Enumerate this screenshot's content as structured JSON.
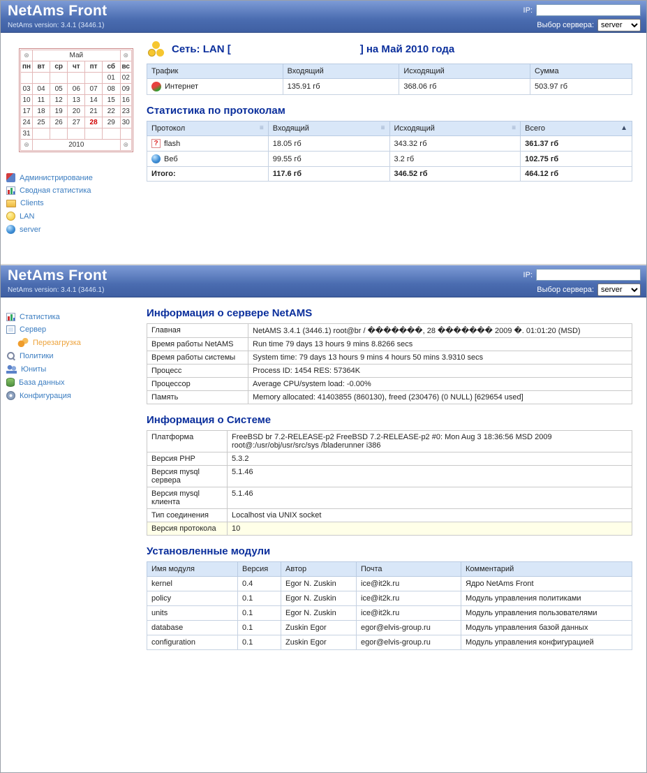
{
  "header": {
    "title": "NetAms Front",
    "version": "NetAms version: 3.4.1 (3446.1)",
    "ip_label": "IP:",
    "server_label": "Выбор сервера:",
    "server_option": "server"
  },
  "icons": {
    "sort": "≡",
    "sort_active": "▲",
    "nav": "⊛",
    "flash_glyph": "?"
  },
  "section1": {
    "calendar": {
      "month": "Май",
      "year": "2010",
      "dow": [
        "пн",
        "вт",
        "ср",
        "чт",
        "пт",
        "сб",
        "вс"
      ],
      "weeks": [
        [
          "",
          "",
          "",
          "",
          "",
          "01",
          "02"
        ],
        [
          "03",
          "04",
          "05",
          "06",
          "07",
          "08",
          "09"
        ],
        [
          "10",
          "11",
          "12",
          "13",
          "14",
          "15",
          "16"
        ],
        [
          "17",
          "18",
          "19",
          "20",
          "21",
          "22",
          "23"
        ],
        [
          "24",
          "25",
          "26",
          "27",
          "28",
          "29",
          "30"
        ],
        [
          "31",
          "",
          "",
          "",
          "",
          "",
          ""
        ]
      ],
      "selected_day": "28"
    },
    "menu": [
      "Администрирование",
      "Сводная статистика",
      "Clients",
      "LAN",
      "server"
    ],
    "net_title_prefix": "Сеть: LAN [",
    "net_title_suffix": "] на Май 2010 года",
    "traffic": {
      "headers": [
        "Трафик",
        "Входящий",
        "Исходящий",
        "Сумма"
      ],
      "row": [
        "Интернет",
        "135.91 гб",
        "368.06 гб",
        "503.97 гб"
      ]
    },
    "protocols": {
      "heading": "Статистика по протоколам",
      "headers": [
        "Протокол",
        "Входящий",
        "Исходящий",
        "Всего"
      ],
      "rows": [
        [
          "flash",
          "18.05 гб",
          "343.32 гб",
          "361.37 гб"
        ],
        [
          "Веб",
          "99.55 гб",
          "3.2 гб",
          "102.75 гб"
        ]
      ],
      "total": [
        "Итого:",
        "117.6 гб",
        "346.52 гб",
        "464.12 гб"
      ]
    }
  },
  "section2": {
    "menu": [
      "Статистика",
      "Сервер",
      "Перезагрузка",
      "Политики",
      "Юниты",
      "База данных",
      "Конфигурация"
    ],
    "server_info": {
      "heading": "Информация о сервере NetAMS",
      "rows": [
        {
          "label": "Главная",
          "value": "NetAMS 3.4.1 (3446.1) root@br / �������, 28 ������� 2009 �. 01:01:20 (MSD)"
        },
        {
          "label": "Время работы NetAMS",
          "value": "Run time 79 days 13 hours 9 mins 8.8266 secs"
        },
        {
          "label": "Время работы системы",
          "value": "System time: 79 days 13 hours 9 mins 4 hours 50 mins 3.9310 secs"
        },
        {
          "label": "Процесс",
          "value": "Process ID: 1454 RES: 57364K"
        },
        {
          "label": "Процессор",
          "value": "Average CPU/system load: -0.00%"
        },
        {
          "label": "Память",
          "value": "Memory allocated: 41403855 (860130), freed (230476) (0 NULL) [629654 used]"
        }
      ]
    },
    "system_info": {
      "heading": "Информация о Системе",
      "rows": [
        {
          "label": "Платформа",
          "value": "FreeBSD br 7.2-RELEASE-p2 FreeBSD 7.2-RELEASE-p2 #0: Mon Aug 3 18:36:56 MSD 2009 root@:/usr/obj/usr/src/sys /bladerunner i386"
        },
        {
          "label": "Версия PHP",
          "value": "5.3.2"
        },
        {
          "label": "Версия mysql сервера",
          "value": "5.1.46"
        },
        {
          "label": "Версия mysql клиента",
          "value": "5.1.46"
        },
        {
          "label": "Тип соединения",
          "value": "Localhost via UNIX socket"
        },
        {
          "label": "Версия протокола",
          "value": "10"
        }
      ]
    },
    "modules": {
      "heading": "Установленные модули",
      "headers": [
        "Имя модуля",
        "Версия",
        "Автор",
        "Почта",
        "Комментарий"
      ],
      "rows": [
        [
          "kernel",
          "0.4",
          "Egor N. Zuskin",
          "ice@it2k.ru",
          "Ядро NetAms Front"
        ],
        [
          "policy",
          "0.1",
          "Egor N. Zuskin",
          "ice@it2k.ru",
          "Модуль управления политиками"
        ],
        [
          "units",
          "0.1",
          "Egor N. Zuskin",
          "ice@it2k.ru",
          "Модуль управления пользователями"
        ],
        [
          "database",
          "0.1",
          "Zuskin Egor",
          "egor@elvis-group.ru",
          "Модуль управления базой данных"
        ],
        [
          "configuration",
          "0.1",
          "Zuskin Egor",
          "egor@elvis-group.ru",
          "Модуль управления конфигурацией"
        ]
      ]
    }
  }
}
